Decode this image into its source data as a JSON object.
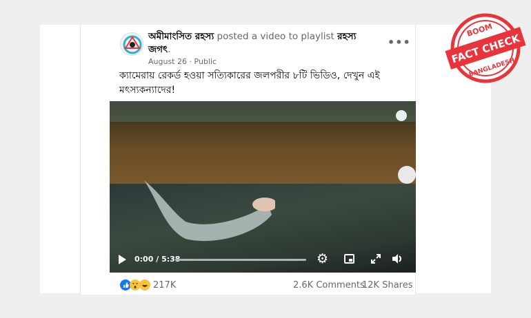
{
  "post": {
    "page_name": "অমীমাংসিত রহস্য",
    "action_text": " posted a video to playlist ",
    "playlist_name": "রহস্য জগৎ",
    "playlist_end": ".",
    "date": "August 26",
    "separator": " · ",
    "privacy": "Public",
    "more_label": "•••",
    "caption": "ক্যামেরায় রেকর্ড হওয়া সত্যিকারের জলপরীর ৮টি ভিডিও, দেখুন এই মৎস্যকন্যাদের!"
  },
  "video": {
    "current_time": "0:00",
    "time_separator": " / ",
    "duration": "5:38",
    "progress": 0.0
  },
  "engagement": {
    "reactions_count": "217K",
    "comments": "2.6K Comments",
    "shares": "12K Shares",
    "reaction_icons": [
      "like-icon",
      "wow-icon",
      "haha-icon"
    ]
  },
  "badge": {
    "top_text": "BOOM",
    "main_text": "FACT CHECK",
    "bottom_text": "BANGLADESH"
  },
  "colors": {
    "badge_red": "#e8343a",
    "facebook_blue": "#1877f2",
    "reaction_yellow": "#f7c33b"
  }
}
